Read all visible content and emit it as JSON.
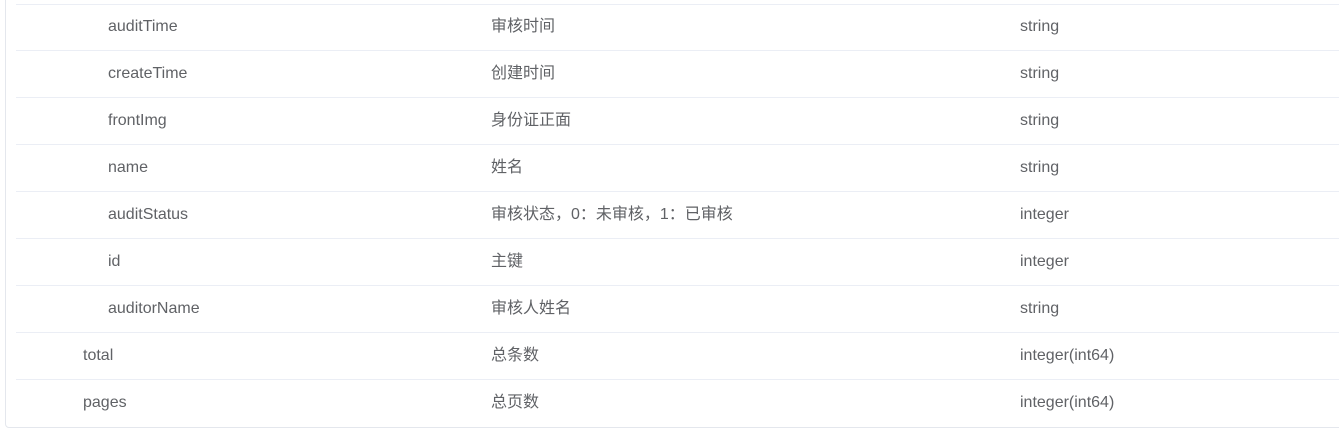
{
  "rows": [
    {
      "name": "auditTime",
      "desc": "审核时间",
      "type": "string",
      "level": 1
    },
    {
      "name": "createTime",
      "desc": "创建时间",
      "type": "string",
      "level": 1
    },
    {
      "name": "frontImg",
      "desc": "身份证正面",
      "type": "string",
      "level": 1
    },
    {
      "name": "name",
      "desc": "姓名",
      "type": "string",
      "level": 1
    },
    {
      "name": "auditStatus",
      "desc": "审核状态，0：未审核，1：已审核",
      "type": "integer",
      "level": 1
    },
    {
      "name": "id",
      "desc": "主键",
      "type": "integer",
      "level": 1
    },
    {
      "name": "auditorName",
      "desc": "审核人姓名",
      "type": "string",
      "level": 1
    },
    {
      "name": "total",
      "desc": "总条数",
      "type": "integer(int64)",
      "level": 0
    },
    {
      "name": "pages",
      "desc": "总页数",
      "type": "integer(int64)",
      "level": 0
    }
  ]
}
